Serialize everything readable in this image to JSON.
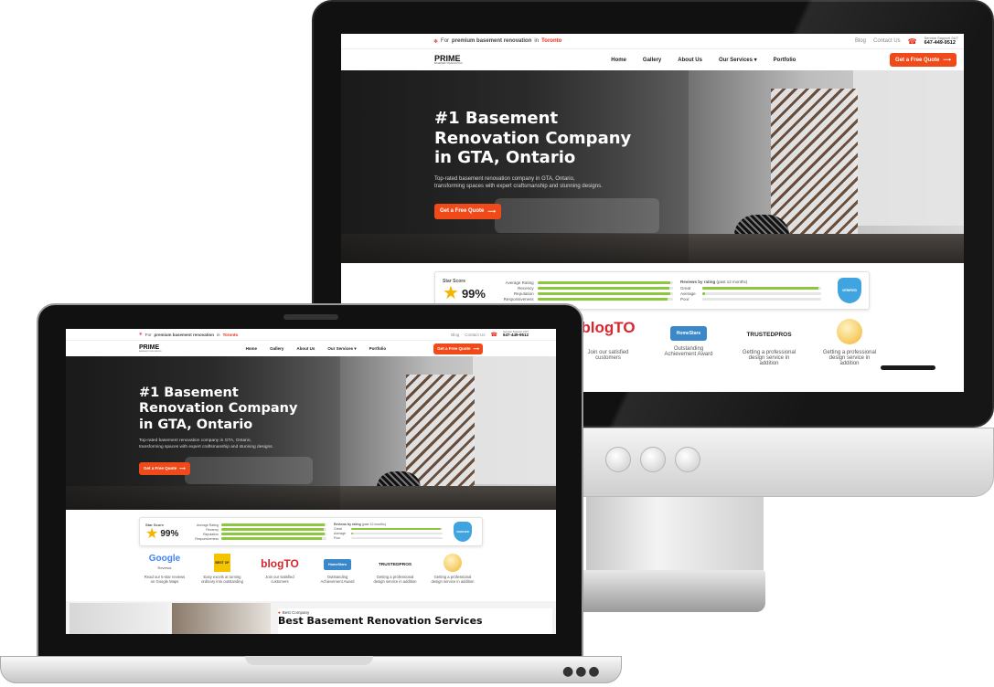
{
  "topbar": {
    "for_text": "For",
    "premium_text": "premium basement renovation",
    "in_text": "in",
    "city": "Toronto",
    "links": [
      "Blog",
      "Contact Us"
    ],
    "support_label": "Service Support 24/7",
    "phone": "647-449-9512"
  },
  "brand": {
    "name": "PRIME",
    "tagline": "BASEMENT RENOVATION"
  },
  "nav": {
    "items": [
      "Home",
      "Gallery",
      "About Us",
      "Our Services",
      "Portfolio"
    ],
    "cta": "Get a Free Quote"
  },
  "hero": {
    "title_line1": "#1 Basement",
    "title_line2": "Renovation Company",
    "title_line3": "in GTA, Ontario",
    "subtitle_line1": "Top-rated basement renovation company in GTA, Ontario,",
    "subtitle_line2": "transforming spaces with expert craftsmanship and stunning designs.",
    "cta": "Get a Free Quote"
  },
  "score": {
    "label": "Star Score",
    "value": "99%",
    "metrics": [
      {
        "label": "Average Rating",
        "level": 0.98
      },
      {
        "label": "Recency",
        "level": 0.97
      },
      {
        "label": "Reputation",
        "level": 0.98
      },
      {
        "label": "Responsiveness",
        "level": 0.96
      }
    ],
    "reviews_title": "Reviews by rating",
    "reviews_period": "(past 12 months)",
    "ratings": [
      {
        "label": "Great",
        "level": 0.98
      },
      {
        "label": "Average",
        "level": 0.02
      },
      {
        "label": "Poor",
        "level": 0.0
      }
    ],
    "badge": "VERIFIED"
  },
  "logos": [
    {
      "mark": "Google",
      "sub": "Reviews",
      "caption_line1": "Read our 5-star reviews",
      "caption_line2": "on Google Maps"
    },
    {
      "mark": "BEST OF",
      "sub": "",
      "caption_line1": "Easy excels at turning",
      "caption_line2": "ordinary into outstanding"
    },
    {
      "mark": "blogTO",
      "sub": "",
      "caption_line1": "Join our satisfied",
      "caption_line2": "customers"
    },
    {
      "mark": "HomeStars",
      "sub": "",
      "caption_line1": "Outstanding",
      "caption_line2": "Achievement Award"
    },
    {
      "mark": "TRUSTEDPROS",
      "sub": "",
      "caption_line1": "Getting a professional",
      "caption_line2": "design service in addition"
    },
    {
      "mark": "",
      "sub": "",
      "caption_line1": "Getting a professional",
      "caption_line2": "design service in addition"
    }
  ],
  "section": {
    "eyebrow": "Best Company",
    "title": "Best Basement Renovation Services"
  },
  "colors": {
    "accent": "#f04a1a",
    "green": "#8dc63f",
    "badge": "#3fa4e0"
  }
}
